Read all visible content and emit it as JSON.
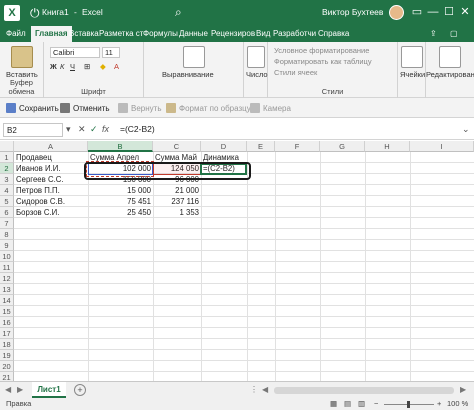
{
  "window": {
    "filename": "Книга1",
    "separator": "-",
    "app": "Excel",
    "search_placeholder": "",
    "user_name": "Виктор Бухтеев"
  },
  "menu_tabs": [
    "Файл",
    "Главная",
    "Вставка",
    "Разметка ст",
    "Формулы",
    "Данные",
    "Рецензиров",
    "Вид",
    "Разработчи",
    "Справка"
  ],
  "ribbon": {
    "clipboard": {
      "paste": "Вставить",
      "group": "Буфер обмена"
    },
    "font": {
      "font_name": "Calibri",
      "font_size": "11",
      "group": "Шрифт"
    },
    "alignment": {
      "label": "Выравнивание"
    },
    "number": {
      "label": "Число"
    },
    "styles": {
      "conditional": "Условное форматирование",
      "table": "Форматировать как таблицу",
      "cell_styles": "Стили ячеек",
      "group": "Стили"
    },
    "cells": {
      "label": "Ячейки"
    },
    "editing": {
      "label": "Редактирование"
    }
  },
  "quick_access": {
    "save": "Сохранить",
    "undo": "Отменить",
    "redo": "Вернуть",
    "format_painter": "Формат по образцу",
    "camera": "Камера"
  },
  "formula_bar": {
    "name_box": "B2",
    "formula": "=(C2-B2)"
  },
  "columns": [
    "A",
    "B",
    "C",
    "D",
    "E",
    "F",
    "G",
    "H",
    "I"
  ],
  "rows": [
    "1",
    "2",
    "3",
    "4",
    "5",
    "6",
    "7",
    "8",
    "9",
    "10",
    "11",
    "12",
    "13",
    "14",
    "15",
    "16",
    "17",
    "18",
    "19",
    "20",
    "21"
  ],
  "cells": {
    "A1": "Продавец",
    "B1": "Сумма Апрел",
    "C1": "Сумма Май",
    "D1": "Динамика",
    "A2": "Иванов И.И.",
    "B2": "102 000",
    "C2": "124 050",
    "D2": "=(C2-B2)",
    "A3": "Сергеев С.С.",
    "B3": "150 000",
    "C3": "96 000",
    "A4": "Петров П.П.",
    "B4": "15 000",
    "C4": "21 000",
    "A5": "Сидоров С.В.",
    "B5": "75 451",
    "C5": "237 116",
    "A6": "Борзов С.И.",
    "B6": "25 450",
    "C6": "1 353"
  },
  "sheet_tabs": [
    "Лист1"
  ],
  "status": {
    "mode": "Правка",
    "zoom": "100 %"
  },
  "colors": {
    "excel_green": "#217346",
    "ref_blue": "#3b5bc8",
    "ref_red": "#c0392b"
  }
}
